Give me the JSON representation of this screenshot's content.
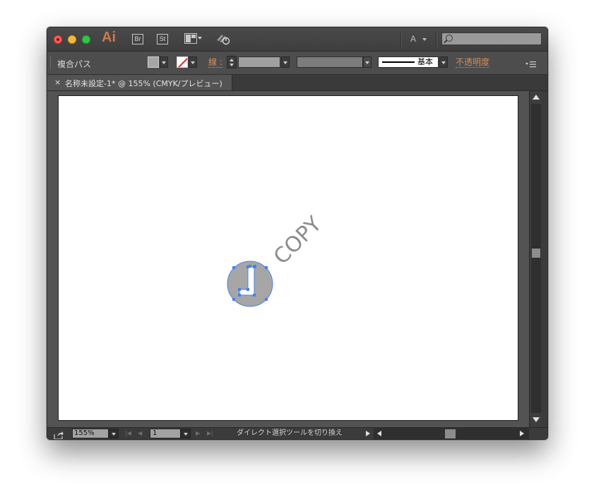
{
  "app": {
    "logo_text": "Ai",
    "bridge_label": "Br",
    "stock_label": "St",
    "workspace_label": "A",
    "search_placeholder": ""
  },
  "control_bar": {
    "selection_type": "複合パス",
    "stroke_label": "線 :",
    "brush_label": "基本",
    "opacity_label": "不透明度"
  },
  "document": {
    "tab_close": "×",
    "tab_title": "名称未設定-1* @ 155% (CMYK/プレビュー)"
  },
  "artwork": {
    "watermark_text": "COPY",
    "fill_color": "#a6a6a6",
    "selection_color": "#4a7fe8"
  },
  "status": {
    "zoom": "155%",
    "page": "1",
    "tool_status": "ダイレクト選択ツールを切り換え"
  },
  "colors": {
    "accent_orange": "#d38e5a",
    "logo_orange": "#c87a4a",
    "ui_dark": "#535353"
  }
}
